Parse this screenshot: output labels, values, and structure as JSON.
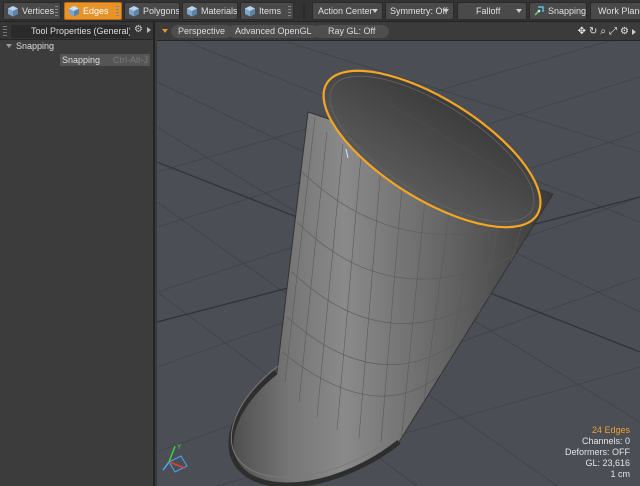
{
  "toolbar": {
    "modes": [
      {
        "label": "Vertices",
        "icon": "vertices-cube-icon",
        "active": false
      },
      {
        "label": "Edges",
        "icon": "edges-cube-icon",
        "active": true
      },
      {
        "label": "Polygons",
        "icon": "polygons-cube-icon",
        "active": false
      },
      {
        "label": "Materials",
        "icon": "materials-cube-icon",
        "active": false
      },
      {
        "label": "Items",
        "icon": "items-cube-icon",
        "active": false
      }
    ],
    "action_center": "Action Center",
    "symmetry": "Symmetry: Off",
    "falloff": "Falloff",
    "snapping": "Snapping",
    "work_plane": "Work Plane"
  },
  "panel": {
    "tab_title": "Tool Properties (General)",
    "tab_suffix": "⚙",
    "section": "Snapping",
    "snapping_button": "Snapping",
    "snapping_shortcut": "Ctrl-Alt-J"
  },
  "viewport": {
    "view": "Perspective",
    "renderer": "Advanced OpenGL",
    "raygl": "Ray GL: Off",
    "icons": [
      "move-view-icon",
      "rotate-view-icon",
      "zoom-view-icon",
      "maximize-view-icon",
      "gear-icon",
      "expand-arrow-icon"
    ]
  },
  "stats": {
    "selection": "24 Edges",
    "channels": "Channels: 0",
    "deformers": "Deformers: OFF",
    "gl": "GL: 23,616",
    "unit": "1 cm"
  },
  "colors": {
    "accent": "#e8922a",
    "viewport_bg": "#4b4f55",
    "selection_edge": "#f5a623"
  }
}
